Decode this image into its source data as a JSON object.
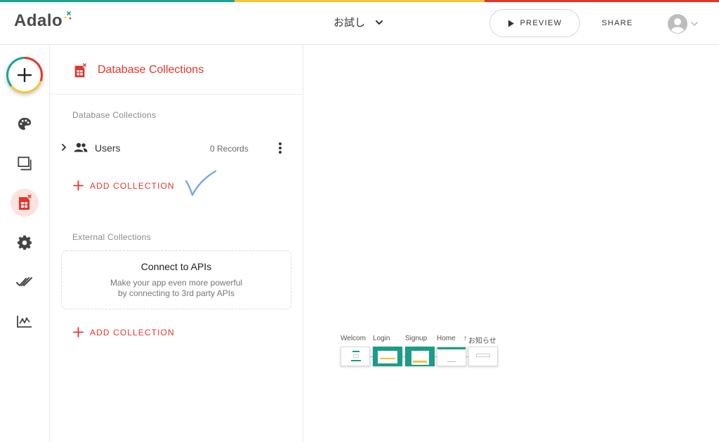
{
  "header": {
    "logo": "Adalo",
    "app_name": "お試し",
    "preview_label": "PREVIEW",
    "share_label": "SHARE"
  },
  "colors": {
    "accent_red": "#e5352b",
    "accent_yellow": "#f5c536",
    "accent_teal": "#19a58f"
  },
  "rail": {
    "items": [
      "palette-icon",
      "screens-icon",
      "database-icon",
      "gear-icon",
      "publish-checks-icon",
      "analytics-icon"
    ],
    "active": "database-icon"
  },
  "panel": {
    "title": "Database Collections",
    "db_section_label": "Database Collections",
    "collections": [
      {
        "name": "Users",
        "records": "0 Records"
      }
    ],
    "add_collection_label": "ADD COLLECTION",
    "external_section_label": "External Collections",
    "api_card": {
      "title": "Connect to APIs",
      "desc_line1": "Make your app even more powerful",
      "desc_line2": "by connecting to 3rd party APIs"
    },
    "add_external_label": "ADD COLLECTION"
  },
  "canvas": {
    "screens": [
      "Welcom",
      "Login",
      "Signup",
      "Home",
      "お知らせ"
    ]
  }
}
